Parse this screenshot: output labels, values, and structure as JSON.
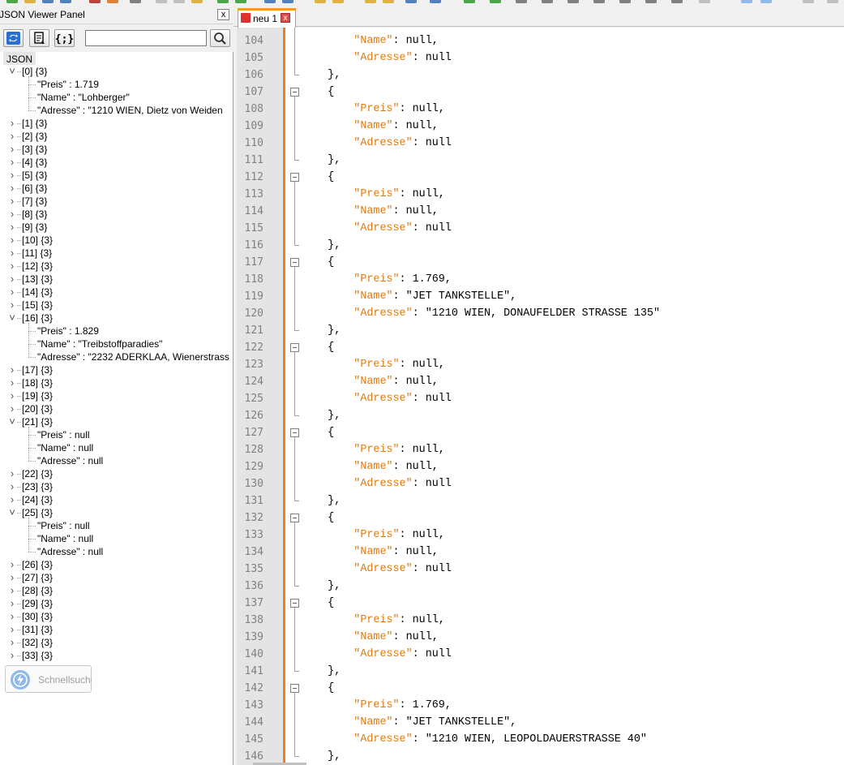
{
  "panel": {
    "title": "JSON Viewer Panel",
    "close_glyph": "x",
    "search_placeholder": "",
    "root_label": "JSON",
    "quick_search_label": "Schnellsuche"
  },
  "tree": [
    {
      "label": "[0] {3}",
      "expanded": true,
      "children": [
        "\"Preis\" : 1.719",
        "\"Name\" : \"Lohberger\"",
        "\"Adresse\" : \"1210 WIEN, Dietz von Weiden"
      ]
    },
    {
      "label": "[1] {3}"
    },
    {
      "label": "[2] {3}"
    },
    {
      "label": "[3] {3}"
    },
    {
      "label": "[4] {3}"
    },
    {
      "label": "[5] {3}"
    },
    {
      "label": "[6] {3}"
    },
    {
      "label": "[7] {3}"
    },
    {
      "label": "[8] {3}"
    },
    {
      "label": "[9] {3}"
    },
    {
      "label": "[10] {3}"
    },
    {
      "label": "[11] {3}"
    },
    {
      "label": "[12] {3}"
    },
    {
      "label": "[13] {3}"
    },
    {
      "label": "[14] {3}"
    },
    {
      "label": "[15] {3}"
    },
    {
      "label": "[16] {3}",
      "expanded": true,
      "children": [
        "\"Preis\" : 1.829",
        "\"Name\" : \"Treibstoffparadies\"",
        "\"Adresse\" : \"2232 ADERKLAA, Wienerstrass"
      ]
    },
    {
      "label": "[17] {3}"
    },
    {
      "label": "[18] {3}"
    },
    {
      "label": "[19] {3}"
    },
    {
      "label": "[20] {3}"
    },
    {
      "label": "[21] {3}",
      "expanded": true,
      "children": [
        "\"Preis\" : null",
        "\"Name\" : null",
        "\"Adresse\" : null"
      ]
    },
    {
      "label": "[22] {3}"
    },
    {
      "label": "[23] {3}"
    },
    {
      "label": "[24] {3}"
    },
    {
      "label": "[25] {3}",
      "expanded": true,
      "children": [
        "\"Preis\" : null",
        "\"Name\" : null",
        "\"Adresse\" : null"
      ]
    },
    {
      "label": "[26] {3}"
    },
    {
      "label": "[27] {3}"
    },
    {
      "label": "[28] {3}"
    },
    {
      "label": "[29] {3}"
    },
    {
      "label": "[30] {3}"
    },
    {
      "label": "[31] {3}"
    },
    {
      "label": "[32] {3}"
    },
    {
      "label": "[33] {3}"
    }
  ],
  "tab": {
    "label": "neu 1",
    "close_glyph": "x"
  },
  "editor": {
    "lines": [
      {
        "n": "104",
        "indent": "        ",
        "key": "\"Name\"",
        "rest": ": null,"
      },
      {
        "n": "105",
        "indent": "        ",
        "key": "\"Adresse\"",
        "rest": ": null"
      },
      {
        "n": "106",
        "indent": "    ",
        "key": "",
        "rest": "},",
        "fold": "end"
      },
      {
        "n": "107",
        "indent": "    ",
        "key": "",
        "rest": "{",
        "fold": "start"
      },
      {
        "n": "108",
        "indent": "        ",
        "key": "\"Preis\"",
        "rest": ": null,"
      },
      {
        "n": "109",
        "indent": "        ",
        "key": "\"Name\"",
        "rest": ": null,"
      },
      {
        "n": "110",
        "indent": "        ",
        "key": "\"Adresse\"",
        "rest": ": null"
      },
      {
        "n": "111",
        "indent": "    ",
        "key": "",
        "rest": "},",
        "fold": "end"
      },
      {
        "n": "112",
        "indent": "    ",
        "key": "",
        "rest": "{",
        "fold": "start"
      },
      {
        "n": "113",
        "indent": "        ",
        "key": "\"Preis\"",
        "rest": ": null,"
      },
      {
        "n": "114",
        "indent": "        ",
        "key": "\"Name\"",
        "rest": ": null,"
      },
      {
        "n": "115",
        "indent": "        ",
        "key": "\"Adresse\"",
        "rest": ": null"
      },
      {
        "n": "116",
        "indent": "    ",
        "key": "",
        "rest": "},",
        "fold": "end"
      },
      {
        "n": "117",
        "indent": "    ",
        "key": "",
        "rest": "{",
        "fold": "start"
      },
      {
        "n": "118",
        "indent": "        ",
        "key": "\"Preis\"",
        "rest": ": 1.769,"
      },
      {
        "n": "119",
        "indent": "        ",
        "key": "\"Name\"",
        "rest": ": \"JET TANKSTELLE\","
      },
      {
        "n": "120",
        "indent": "        ",
        "key": "\"Adresse\"",
        "rest": ": \"1210 WIEN, DONAUFELDER STRASSE 135\""
      },
      {
        "n": "121",
        "indent": "    ",
        "key": "",
        "rest": "},",
        "fold": "end"
      },
      {
        "n": "122",
        "indent": "    ",
        "key": "",
        "rest": "{",
        "fold": "start"
      },
      {
        "n": "123",
        "indent": "        ",
        "key": "\"Preis\"",
        "rest": ": null,"
      },
      {
        "n": "124",
        "indent": "        ",
        "key": "\"Name\"",
        "rest": ": null,"
      },
      {
        "n": "125",
        "indent": "        ",
        "key": "\"Adresse\"",
        "rest": ": null"
      },
      {
        "n": "126",
        "indent": "    ",
        "key": "",
        "rest": "},",
        "fold": "end"
      },
      {
        "n": "127",
        "indent": "    ",
        "key": "",
        "rest": "{",
        "fold": "start"
      },
      {
        "n": "128",
        "indent": "        ",
        "key": "\"Preis\"",
        "rest": ": null,"
      },
      {
        "n": "129",
        "indent": "        ",
        "key": "\"Name\"",
        "rest": ": null,"
      },
      {
        "n": "130",
        "indent": "        ",
        "key": "\"Adresse\"",
        "rest": ": null"
      },
      {
        "n": "131",
        "indent": "    ",
        "key": "",
        "rest": "},",
        "fold": "end"
      },
      {
        "n": "132",
        "indent": "    ",
        "key": "",
        "rest": "{",
        "fold": "start"
      },
      {
        "n": "133",
        "indent": "        ",
        "key": "\"Preis\"",
        "rest": ": null,"
      },
      {
        "n": "134",
        "indent": "        ",
        "key": "\"Name\"",
        "rest": ": null,"
      },
      {
        "n": "135",
        "indent": "        ",
        "key": "\"Adresse\"",
        "rest": ": null"
      },
      {
        "n": "136",
        "indent": "    ",
        "key": "",
        "rest": "},",
        "fold": "end"
      },
      {
        "n": "137",
        "indent": "    ",
        "key": "",
        "rest": "{",
        "fold": "start"
      },
      {
        "n": "138",
        "indent": "        ",
        "key": "\"Preis\"",
        "rest": ": null,"
      },
      {
        "n": "139",
        "indent": "        ",
        "key": "\"Name\"",
        "rest": ": null,"
      },
      {
        "n": "140",
        "indent": "        ",
        "key": "\"Adresse\"",
        "rest": ": null"
      },
      {
        "n": "141",
        "indent": "    ",
        "key": "",
        "rest": "},",
        "fold": "end"
      },
      {
        "n": "142",
        "indent": "    ",
        "key": "",
        "rest": "{",
        "fold": "start"
      },
      {
        "n": "143",
        "indent": "        ",
        "key": "\"Preis\"",
        "rest": ": 1.769,"
      },
      {
        "n": "144",
        "indent": "        ",
        "key": "\"Name\"",
        "rest": ": \"JET TANKSTELLE\","
      },
      {
        "n": "145",
        "indent": "        ",
        "key": "\"Adresse\"",
        "rest": ": \"1210 WIEN, LEOPOLDAUERSTRASSE 40\""
      },
      {
        "n": "146",
        "indent": "    ",
        "key": "",
        "rest": "},",
        "fold": "end"
      }
    ]
  },
  "colors": {
    "key": "#e07a10",
    "change_bar": "#f07f1a",
    "gutter": "#e4e4e4"
  }
}
